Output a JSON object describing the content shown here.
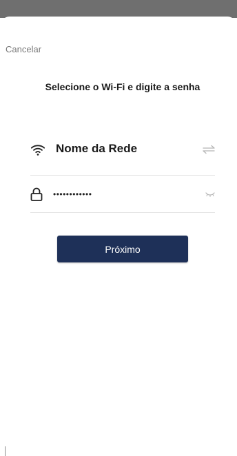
{
  "header": {
    "cancel_label": "Cancelar",
    "title": "Selecione o Wi-Fi e digite a senha"
  },
  "wifi": {
    "ssid": "Nome da Rede",
    "icon": "wifi-icon",
    "switch_icon": "switch-network-icon"
  },
  "password": {
    "value": "••••••••••••",
    "icon": "lock-icon",
    "visibility_icon": "eye-closed-icon"
  },
  "actions": {
    "next_label": "Próximo"
  },
  "colors": {
    "primary_button": "#1e3058",
    "status_bar": "#6f6f6f",
    "divider": "#e6e6e6",
    "muted_text": "#7a7a7a"
  }
}
